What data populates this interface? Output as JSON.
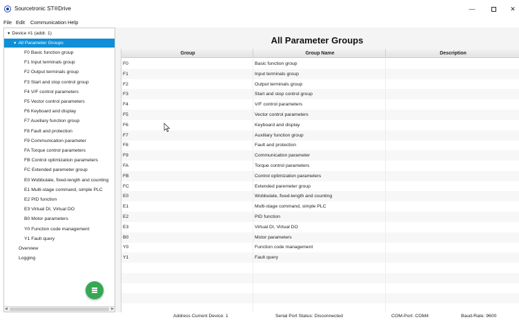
{
  "window": {
    "title": "Sourcetronic ST®Drive",
    "minimize_label": "—",
    "close_label": "✕",
    "icon": "app-logo-icon"
  },
  "menu": [
    "File",
    "Edit",
    "Communication",
    "Help"
  ],
  "sidebar": {
    "device_label": "Device #1 (addr. 1)",
    "all_groups_label": "All Parameter Groups",
    "groups": [
      "F0 Basic function group",
      "F1 Input terminals group",
      "F2 Output terminals group",
      "F3 Start and stop control group",
      "F4 V/F control parameters",
      "F5 Vector control parameters",
      "F6 Keyboard and display",
      "F7 Auxiliary function group",
      "F8 Fault and protection",
      "F9 Communication parameter",
      "FA Torque control parameters",
      "FB Control optimization parameters",
      "FC Extended paremeter group",
      "E0 Wobbulate, fixed-length and counting",
      "E1 Multi-stage command, simple PLC",
      "E2 PID function",
      "E3 Virtual DI, Virtual DO",
      "B0 Motor parameters",
      "Y0 Function code management",
      "Y1 Fault query"
    ],
    "overview_label": "Overview",
    "logging_label": "Logging",
    "fab_icon": "menu-icon"
  },
  "main": {
    "title": "All Parameter Groups",
    "columns": [
      "Group",
      "Group Name",
      "Description"
    ],
    "rows": [
      {
        "group": "F0",
        "name": "Basic function group",
        "description": ""
      },
      {
        "group": "F1",
        "name": "Input terminals group",
        "description": ""
      },
      {
        "group": "F2",
        "name": "Output terminals group",
        "description": ""
      },
      {
        "group": "F3",
        "name": "Start and stop control group",
        "description": ""
      },
      {
        "group": "F4",
        "name": "V/F control parameters",
        "description": ""
      },
      {
        "group": "F5",
        "name": "Vector control parameters",
        "description": ""
      },
      {
        "group": "F6",
        "name": "Keyboard and display",
        "description": ""
      },
      {
        "group": "F7",
        "name": "Auxiliary function group",
        "description": ""
      },
      {
        "group": "F8",
        "name": "Fault and protection",
        "description": ""
      },
      {
        "group": "F9",
        "name": "Communication parameter",
        "description": ""
      },
      {
        "group": "FA",
        "name": "Torque control parameters",
        "description": ""
      },
      {
        "group": "FB",
        "name": "Control optimization parameters",
        "description": ""
      },
      {
        "group": "FC",
        "name": "Extended paremeter group",
        "description": ""
      },
      {
        "group": "E0",
        "name": "Wobbulate, fixed-length and counting",
        "description": ""
      },
      {
        "group": "E1",
        "name": "Multi-stage command, simple PLC",
        "description": ""
      },
      {
        "group": "E2",
        "name": "PID function",
        "description": ""
      },
      {
        "group": "E3",
        "name": "Virtual DI, Virtual DO",
        "description": ""
      },
      {
        "group": "B0",
        "name": "Motor parameters",
        "description": ""
      },
      {
        "group": "Y0",
        "name": "Function code management",
        "description": ""
      },
      {
        "group": "Y1",
        "name": "Fault query",
        "description": ""
      }
    ],
    "empty_rows": 5
  },
  "status": {
    "address": "Address Current Device: 1",
    "serial": "Serial Port Status: Disconnected",
    "com": "COM-Port: COM4",
    "baud": "Baud-Rate: 9600"
  },
  "colors": {
    "selection": "#0e8fd7",
    "fab": "#35a853",
    "app_icon": "#1f3fa8"
  }
}
